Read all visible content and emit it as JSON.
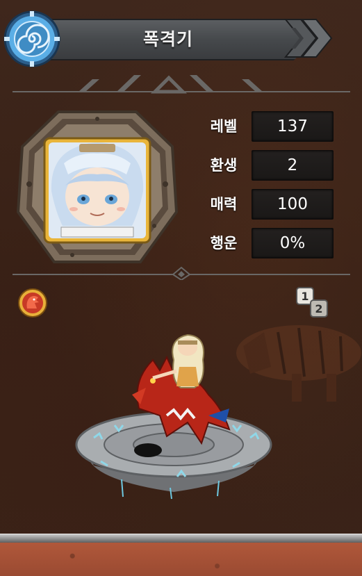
{
  "header": {
    "title": "폭격기",
    "emblem_icon": "spiral-emblem-icon",
    "nav_icon": "double-chevron-right-icon"
  },
  "stats": [
    {
      "label": "레벨",
      "value": "137"
    },
    {
      "label": "환생",
      "value": "2"
    },
    {
      "label": "매력",
      "value": "100"
    },
    {
      "label": "행운",
      "value": "0%"
    }
  ],
  "scene": {
    "pet_badge_icon": "red-dragon-badge-icon",
    "swap_icon": {
      "top": "1",
      "bottom": "2"
    }
  },
  "colors": {
    "background": "#3b2318",
    "title_bar": "#4a4c4f",
    "stat_box": "#1e1c1b",
    "frame": "#8a7a66",
    "emblem": "#4a9fd8",
    "floor": "#a5503a"
  }
}
